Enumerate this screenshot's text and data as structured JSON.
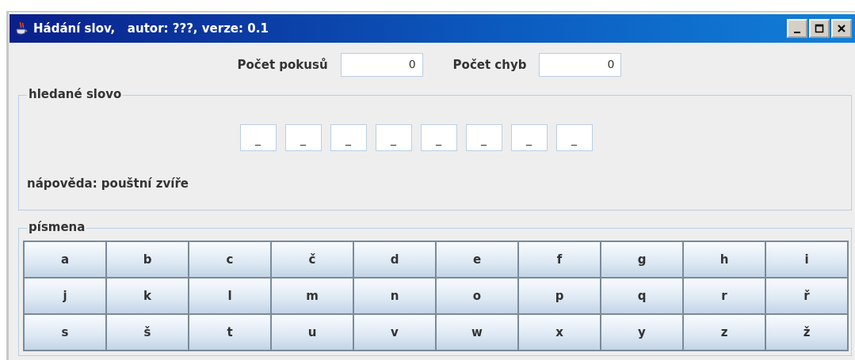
{
  "window": {
    "title": "Hádání slov,   autor: ???, verze: 0.1"
  },
  "counters": [
    {
      "label": "Počet pokusů",
      "value": "0"
    },
    {
      "label": "Počet chyb",
      "value": "0"
    }
  ],
  "word_panel": {
    "title": "hledané slovo",
    "slots": [
      "_",
      "_",
      "_",
      "_",
      "_",
      "_",
      "_",
      "_"
    ],
    "hint": "nápověda: pouštní zvíře"
  },
  "letters_panel": {
    "title": "písmena",
    "letters": [
      "a",
      "b",
      "c",
      "č",
      "d",
      "e",
      "f",
      "g",
      "h",
      "i",
      "j",
      "k",
      "l",
      "m",
      "n",
      "o",
      "p",
      "q",
      "r",
      "ř",
      "s",
      "š",
      "t",
      "u",
      "v",
      "w",
      "x",
      "y",
      "z",
      "ž"
    ]
  }
}
